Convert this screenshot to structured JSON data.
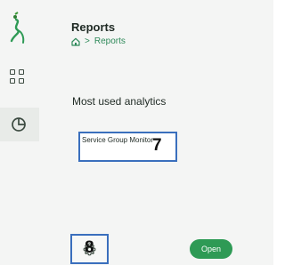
{
  "header": {
    "title": "Reports",
    "breadcrumb": {
      "home_icon": "home-icon",
      "separator": ">",
      "current": "Reports"
    }
  },
  "sidebar": {
    "logo": "runner-logo",
    "items": [
      {
        "icon": "grid-icon",
        "active": false
      },
      {
        "icon": "pie-chart-icon",
        "active": true
      }
    ],
    "settings": {
      "icon": "gear-icon"
    }
  },
  "main": {
    "section_title": "Most used analytics",
    "cards": [
      {
        "label": "Service Group Monitor"
      }
    ],
    "open_label": "Open"
  },
  "annotations": {
    "card_marker": "7",
    "settings_marker": "8"
  },
  "colors": {
    "accent_green": "#2e9a55",
    "highlight_blue": "#3a6fbd",
    "sidebar_bg": "#f4f5f4"
  }
}
